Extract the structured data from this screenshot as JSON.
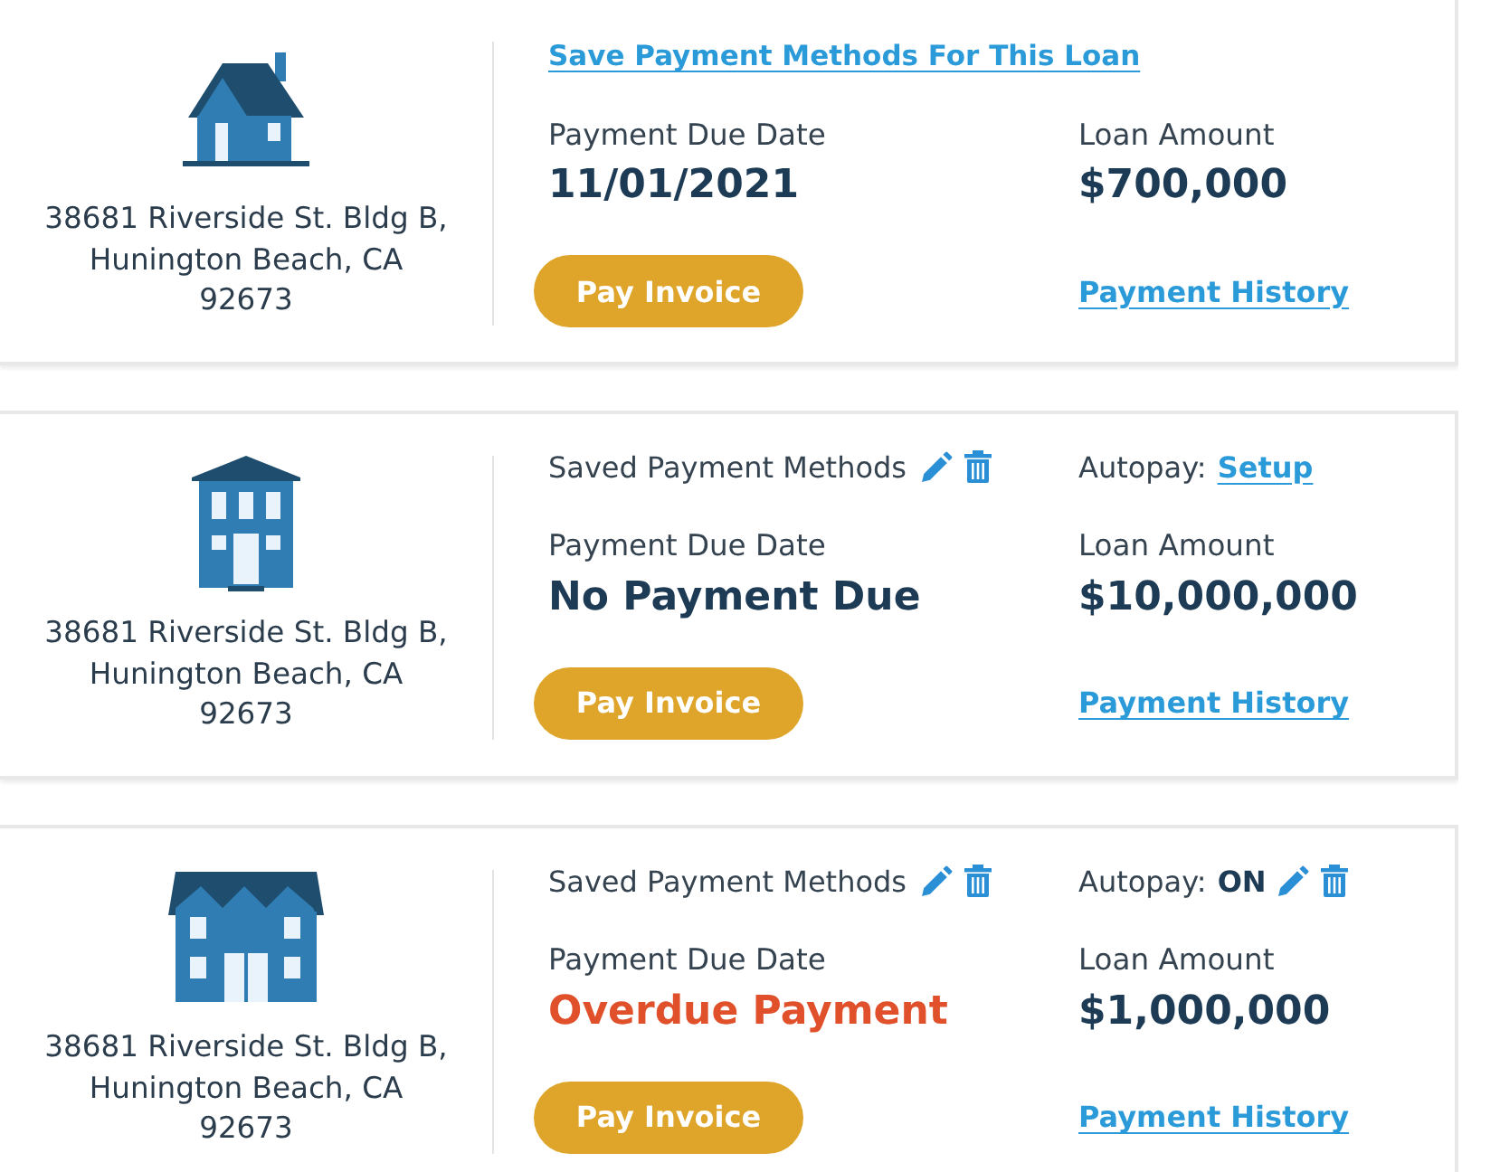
{
  "loans": [
    {
      "property": {
        "kind": "house",
        "address": "38681 Riverside St. Bldg B,\nHunington Beach, CA\n92673"
      },
      "save_link": "Save Payment Methods For This Loan",
      "due": {
        "label": "Payment Due Date",
        "value": "11/01/2021",
        "overdue": false
      },
      "amount": {
        "label": "Loan Amount",
        "value": "$700,000"
      },
      "pay_button": "Pay Invoice",
      "history_link": "Payment History"
    },
    {
      "property": {
        "kind": "townhouse",
        "address": "38681 Riverside St. Bldg B,\nHunington Beach, CA\n92673"
      },
      "saved_methods": {
        "label": "Saved Payment Methods"
      },
      "autopay": {
        "label": "Autopay:",
        "value": "Setup",
        "kind": "link"
      },
      "due": {
        "label": "Payment Due Date",
        "value": "No Payment Due",
        "overdue": false
      },
      "amount": {
        "label": "Loan Amount",
        "value": "$10,000,000"
      },
      "pay_button": "Pay Invoice",
      "history_link": "Payment History"
    },
    {
      "property": {
        "kind": "duplex",
        "address": "38681 Riverside St. Bldg B,\nHunington Beach, CA\n92673"
      },
      "saved_methods": {
        "label": "Saved Payment Methods"
      },
      "autopay": {
        "label": "Autopay:",
        "value": "ON",
        "kind": "status"
      },
      "due": {
        "label": "Payment Due Date",
        "value": "Overdue Payment",
        "overdue": true
      },
      "amount": {
        "label": "Loan Amount",
        "value": "$1,000,000"
      },
      "pay_button": "Pay Invoice",
      "history_link": "Payment History"
    }
  ]
}
